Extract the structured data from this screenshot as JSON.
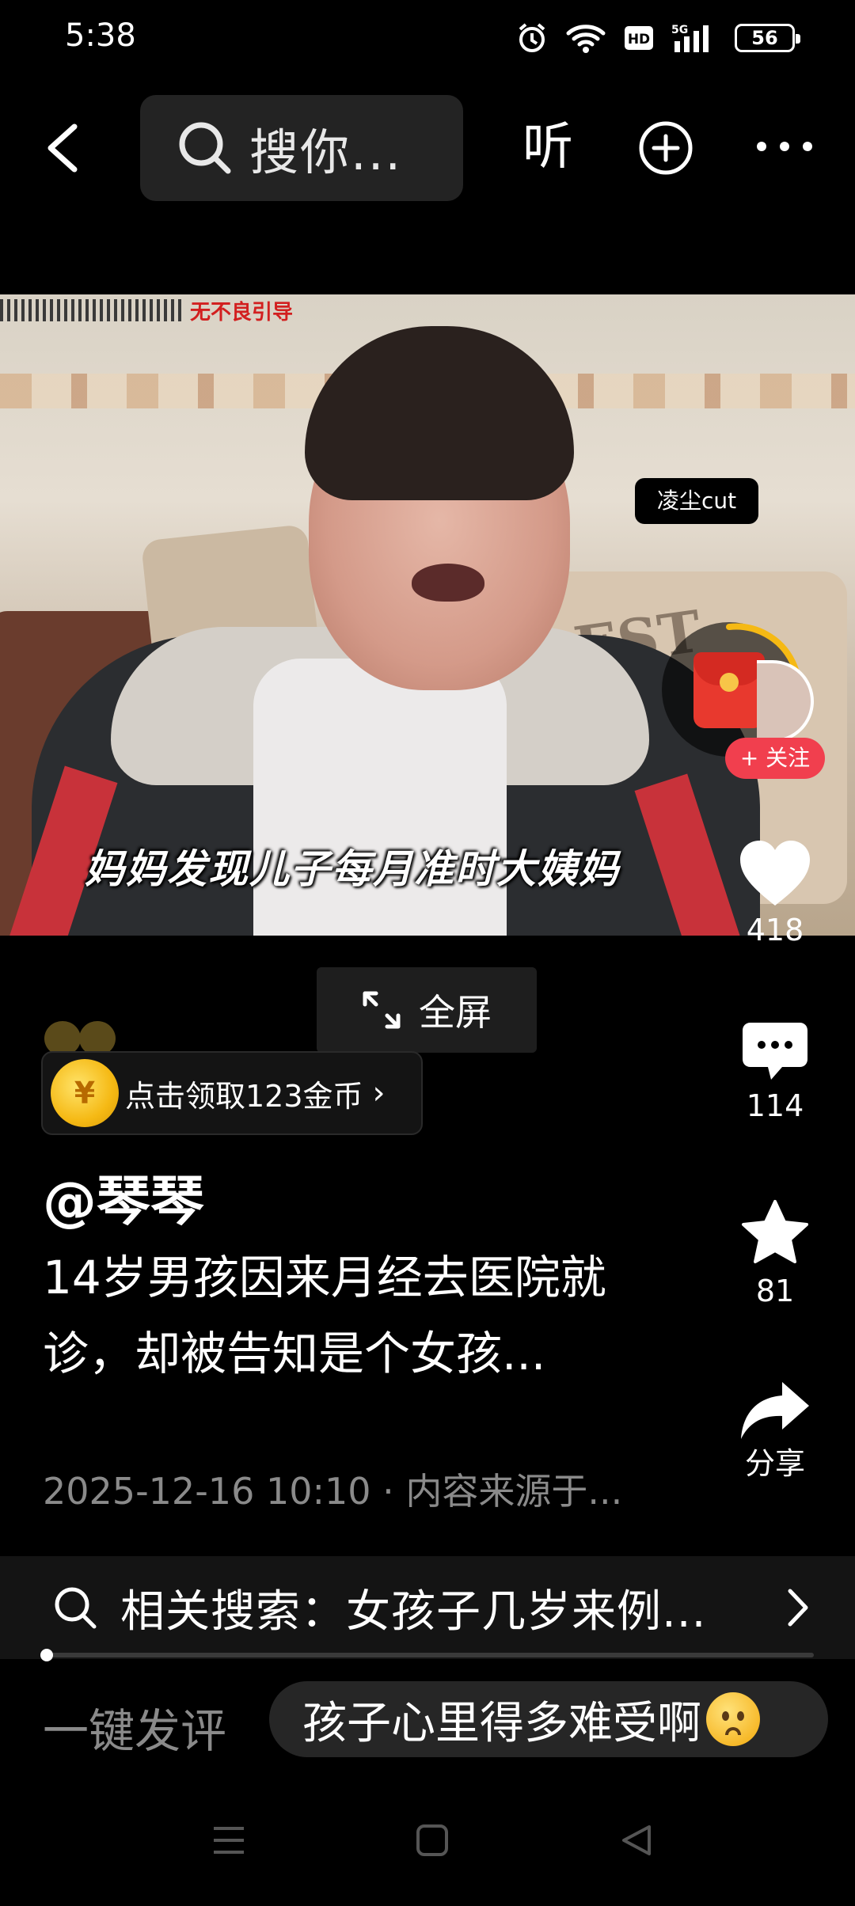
{
  "status_bar": {
    "time": "5:38",
    "battery": "56",
    "icons": [
      "alarm-icon",
      "wifi-icon",
      "hd-icon",
      "5g-signal-icon",
      "battery-icon"
    ]
  },
  "top_bar": {
    "search_placeholder": "搜你...",
    "listen_label": "听",
    "icons": [
      "back-icon",
      "search-icon",
      "add-circle-icon",
      "more-icon"
    ]
  },
  "video": {
    "watermark": "无不良引导",
    "channel_badge": "凌尘cut",
    "subtitle": "妈妈发现儿子每月准时大姨妈",
    "fullscreen_label": "全屏"
  },
  "right_rail": {
    "follow_label": "+ 关注",
    "like_count": "418",
    "comment_count": "114",
    "favorite_count": "81",
    "share_label": "分享"
  },
  "reward": {
    "coin_glyph": "¥",
    "label": "点击领取123金币",
    "chevron": "›"
  },
  "post": {
    "author": "@琴琴",
    "caption": "14岁男孩因来月经去医院就诊，却被告知是个女孩...",
    "meta": "2025-12-16 10:10 · 内容来源于..."
  },
  "related_search": {
    "label": "相关搜索：女孩子几岁来例..."
  },
  "playback": {
    "progress": 0.005
  },
  "quick_comment": {
    "label": "一键发评",
    "suggestion": "孩子心里得多难受啊"
  },
  "colors": {
    "background": "#000000",
    "follow_red": "#f13f4e",
    "coin_gold": "#f5b914",
    "muted_text": "#8a8a8a"
  }
}
